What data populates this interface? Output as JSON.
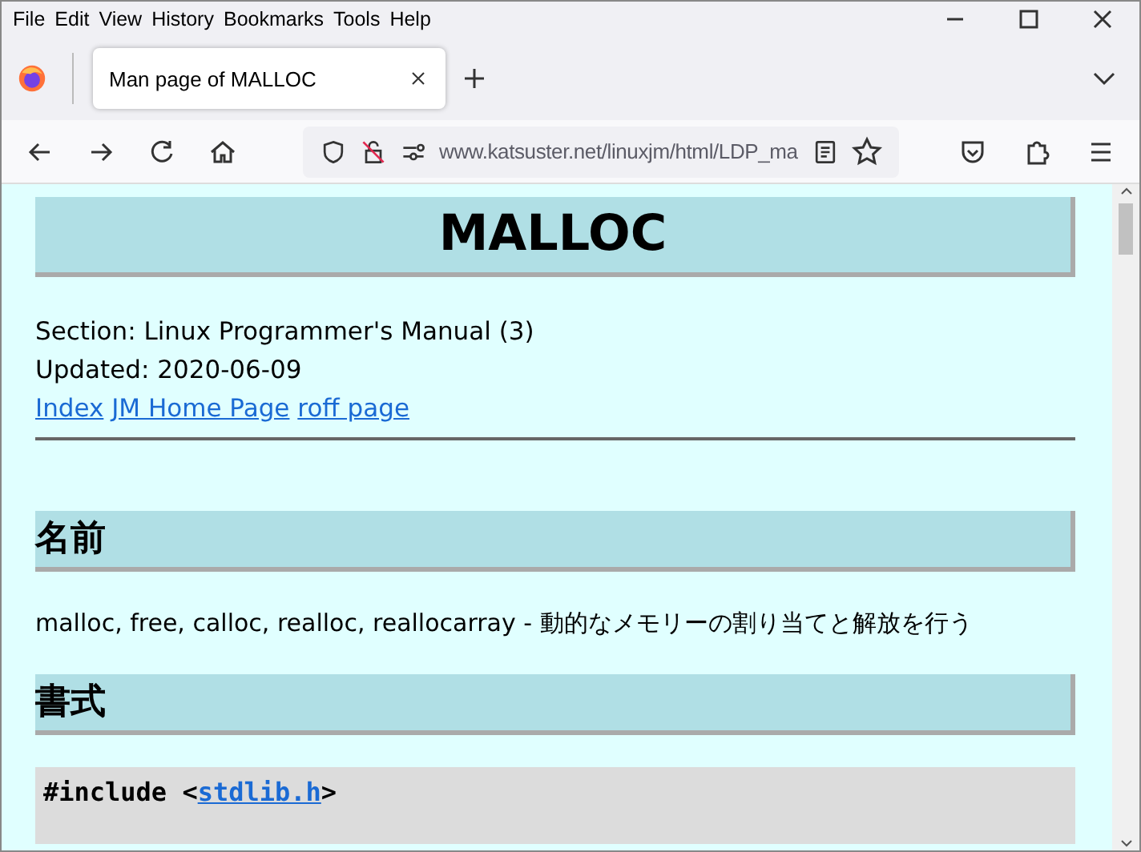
{
  "menu": [
    "File",
    "Edit",
    "View",
    "History",
    "Bookmarks",
    "Tools",
    "Help"
  ],
  "tabs": [
    {
      "label": "Man page of MALLOC",
      "selected": true
    }
  ],
  "address": {
    "url": "www.katsuster.net/linuxjm/html/LDP_ma"
  },
  "page": {
    "title": "MALLOC",
    "section": "Section: Linux Programmer's Manual (3)",
    "updated": "Updated: 2020-06-09",
    "links": [
      "Index",
      "JM Home Page",
      "roff page"
    ],
    "sections": [
      {
        "heading": "名前",
        "body": "malloc, free, calloc, realloc, reallocarray - 動的なメモリーの割り当てと解放を行う"
      },
      {
        "heading": "書式"
      }
    ],
    "code": {
      "before": "#include <",
      "link": "stdlib.h",
      "after": ">"
    }
  }
}
